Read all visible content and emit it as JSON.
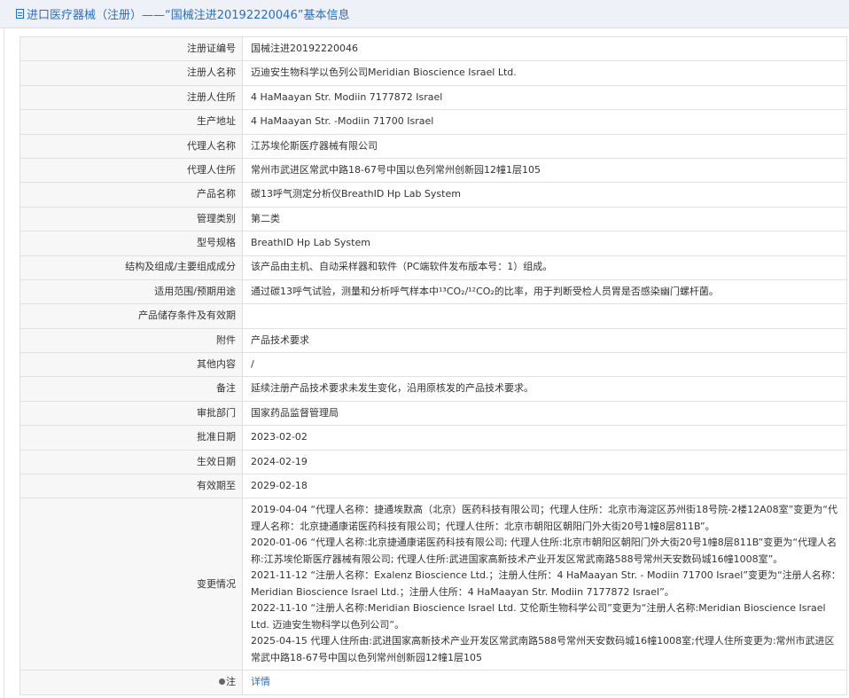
{
  "header": {
    "title": "进口医疗器械（注册）——“国械注进20192220046”基本信息"
  },
  "fields": [
    {
      "label": "注册证编号",
      "value": "国械注进20192220046"
    },
    {
      "label": "注册人名称",
      "value": "迈迪安生物科学以色列公司Meridian Bioscience Israel Ltd."
    },
    {
      "label": "注册人住所",
      "value": "4 HaMaayan Str. Modiin 7177872 Israel"
    },
    {
      "label": "生产地址",
      "value": "4 HaMaayan Str. -Modiin 71700 Israel"
    },
    {
      "label": "代理人名称",
      "value": "江苏埃伦斯医疗器械有限公司"
    },
    {
      "label": "代理人住所",
      "value": "常州市武进区常武中路18-67号中国以色列常州创新园12幢1层105"
    },
    {
      "label": "产品名称",
      "value": "碳13呼气测定分析仪BreathID Hp Lab System"
    },
    {
      "label": "管理类别",
      "value": "第二类"
    },
    {
      "label": "型号规格",
      "value": "BreathID Hp Lab System"
    },
    {
      "label": "结构及组成/主要组成成分",
      "value": "该产品由主机、自动采样器和软件（PC端软件发布版本号：1）组成。"
    },
    {
      "label": "适用范围/预期用途",
      "value": "通过碳13呼气试验，测量和分析呼气样本中¹³CO₂/¹²CO₂的比率，用于判断受检人员胃是否感染幽门螺杆菌。"
    },
    {
      "label": "产品储存条件及有效期",
      "value": ""
    },
    {
      "label": "附件",
      "value": "产品技术要求"
    },
    {
      "label": "其他内容",
      "value": "/"
    },
    {
      "label": "备注",
      "value": "延续注册产品技术要求未发生变化，沿用原核发的产品技术要求。"
    },
    {
      "label": "审批部门",
      "value": "国家药品监督管理局"
    },
    {
      "label": "批准日期",
      "value": "2023-02-02"
    },
    {
      "label": "生效日期",
      "value": "2024-02-19"
    },
    {
      "label": "有效期至",
      "value": "2029-02-18"
    }
  ],
  "changes": {
    "label": "变更情况",
    "entries": [
      "2019-04-04 “代理人名称：捷通埃默高（北京）医药科技有限公司；代理人住所：北京市海淀区苏州街18号院-2楼12A08室”变更为“代理人名称：北京捷通康诺医药科技有限公司；代理人住所：北京市朝阳区朝阳门外大街20号1幢8层811B”。",
      "2020-01-06 “代理人名称:北京捷通康诺医药科技有限公司; 代理人住所:北京市朝阳区朝阳门外大街20号1幢8层811B”变更为“代理人名称:江苏埃伦斯医疗器械有限公司; 代理人住所:武进国家高新技术产业开发区常武南路588号常州天安数码城16幢1008室”。",
      "2021-11-12 “注册人名称：Exalenz Bioscience Ltd.；注册人住所：4 HaMaayan Str. - Modiin 71700 Israel”变更为“注册人名称：Meridian Bioscience Israel Ltd.；注册人住所：4 HaMaayan Str. Modiin 7177872 Israel”。",
      "2022-11-10 “注册人名称:Meridian Bioscience Israel Ltd. 艾伦斯生物科学公司”变更为“注册人名称:Meridian Bioscience Israel Ltd. 迈迪安生物科学以色列公司”。",
      "2025-04-15 代理人住所由:武进国家高新技术产业开发区常武南路588号常州天安数码城16幢1008室;代理人住所变更为:常州市武进区常武中路18-67号中国以色列常州创新园12幢1层105"
    ]
  },
  "note": {
    "label": "注",
    "icon": "pin-icon",
    "link_text": "详情"
  }
}
